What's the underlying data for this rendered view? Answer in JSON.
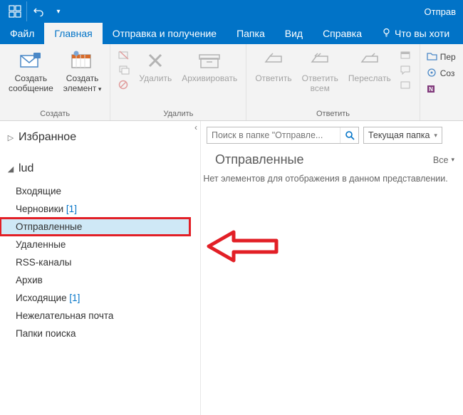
{
  "titlebar": {
    "title": "Отправ"
  },
  "tabs": {
    "file": "Файл",
    "home": "Главная",
    "sendrecv": "Отправка и получение",
    "folder": "Папка",
    "view": "Вид",
    "help": "Справка",
    "tell": "Что вы хоти"
  },
  "ribbon": {
    "create": {
      "newmail": "Создать\nсообщение",
      "newitem": "Создать\nэлемент",
      "label": "Создать"
    },
    "delete": {
      "del": "Удалить",
      "archive": "Архивировать",
      "label": "Удалить"
    },
    "respond": {
      "reply": "Ответить",
      "replyall": "Ответить\nвсем",
      "forward": "Переслать",
      "label": "Ответить"
    },
    "move_side": {
      "move": "Пер",
      "create_rule": "Соз",
      "onenote": ""
    }
  },
  "nav": {
    "favorites": "Избранное",
    "account": "lud",
    "folders": [
      {
        "name": "Входящие",
        "count": null
      },
      {
        "name": "Черновики",
        "count": 1
      },
      {
        "name": "Отправленные",
        "count": null,
        "selected": true
      },
      {
        "name": "Удаленные",
        "count": null
      },
      {
        "name": "RSS-каналы",
        "count": null
      },
      {
        "name": "Архив",
        "count": null
      },
      {
        "name": "Исходящие",
        "count": 1
      },
      {
        "name": "Нежелательная почта",
        "count": null
      },
      {
        "name": "Папки поиска",
        "count": null
      }
    ]
  },
  "main": {
    "search_placeholder": "Поиск в папке \"Отправле...",
    "scope": "Текущая папка",
    "heading": "Отправленные",
    "filter": "Все",
    "empty": "Нет элементов для отображения в данном представлении."
  }
}
